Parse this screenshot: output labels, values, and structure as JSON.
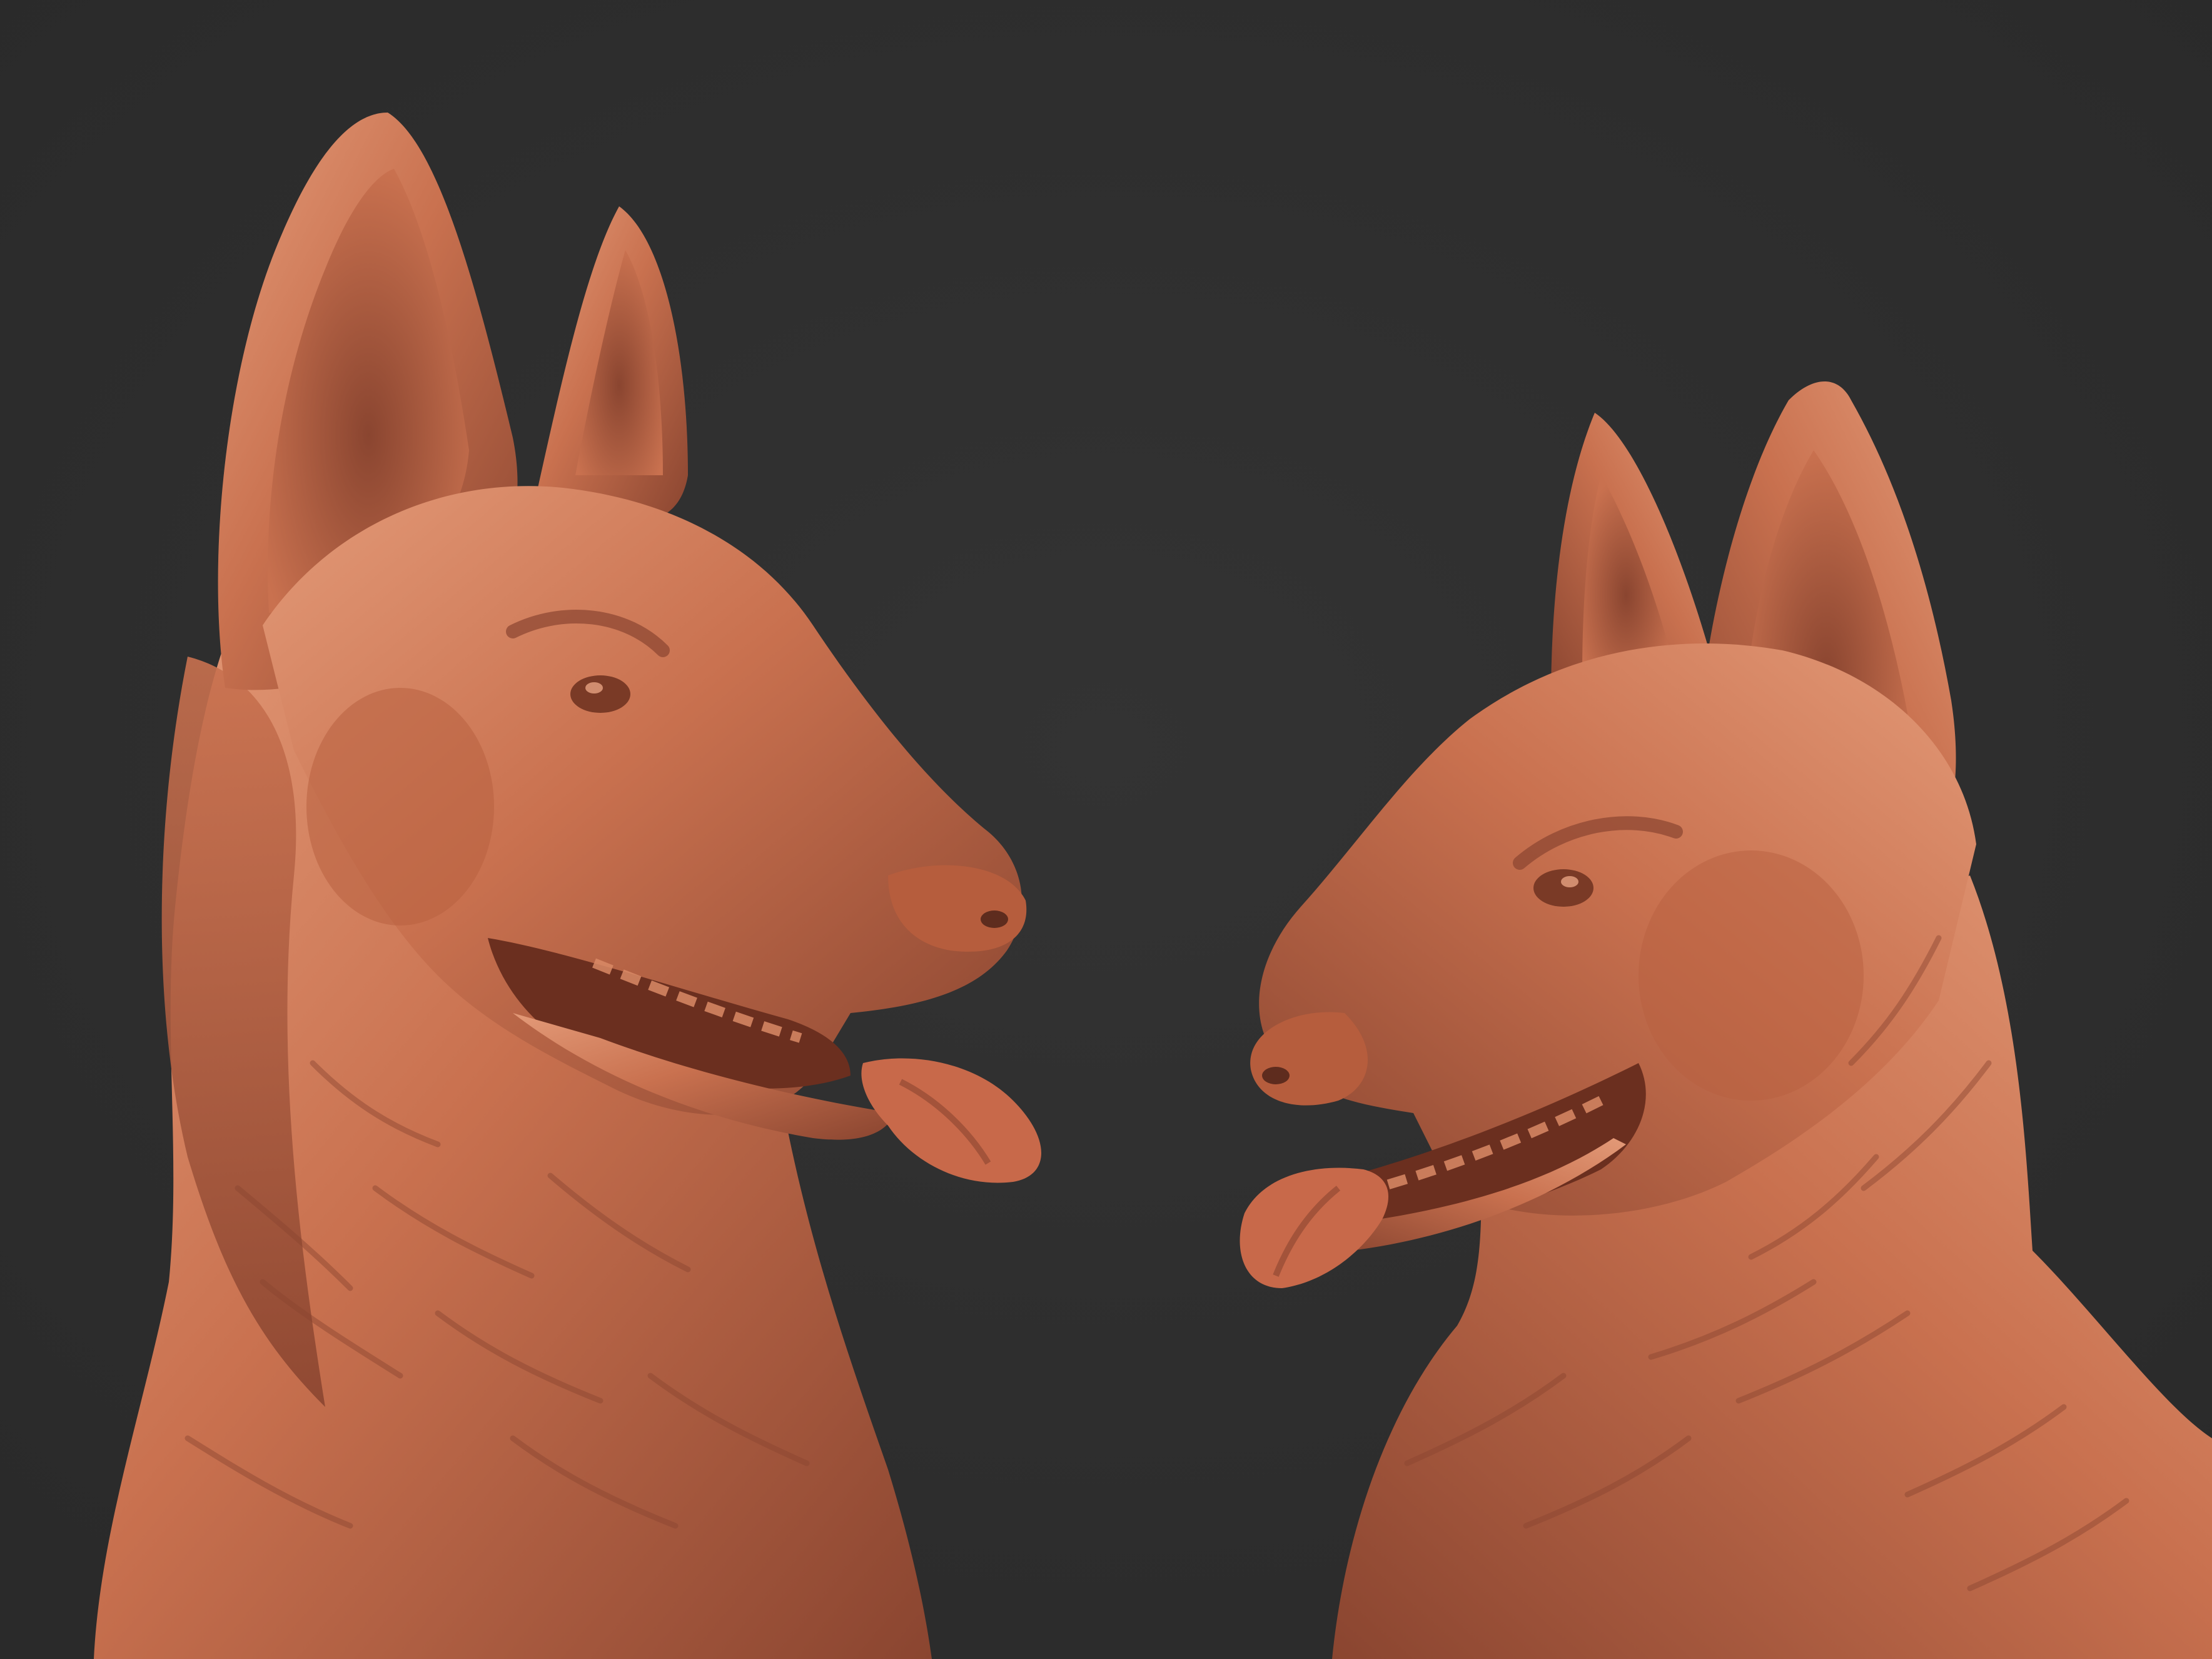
{
  "scene": {
    "background_color": "#2d2d2d",
    "clay_color": "#c9714f",
    "clay_light": "#e39a78",
    "clay_shadow": "#8a4530",
    "clay_deep": "#5e2c1e",
    "subjects": [
      {
        "name": "german-shepherd-bust-left",
        "facing": "right"
      },
      {
        "name": "german-shepherd-bust-right",
        "facing": "left"
      }
    ]
  }
}
